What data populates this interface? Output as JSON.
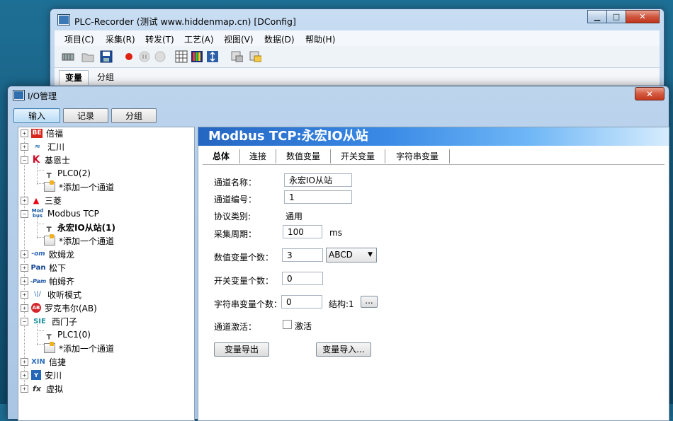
{
  "main_window": {
    "title": "PLC-Recorder (测试 www.hiddenmap.cn) [DConfig]",
    "menu": [
      "项目(C)",
      "采集(R)",
      "转发(T)",
      "工艺(A)",
      "视图(V)",
      "数据(D)",
      "帮助(H)"
    ],
    "tabs": [
      "变量",
      "分组"
    ]
  },
  "io_dialog": {
    "title": "I/O管理",
    "tabs": [
      "输入",
      "记录",
      "分组"
    ],
    "tree": [
      {
        "label": "倍福",
        "logo": "BE"
      },
      {
        "label": "汇川",
        "logo": "≈"
      },
      {
        "label": "基恩士",
        "logo": "K"
      },
      {
        "label": "PLC0(2)"
      },
      {
        "label": "*添加一个通道"
      },
      {
        "label": "三菱",
        "logo": "▲"
      },
      {
        "label": "Modbus TCP",
        "logo_top": "Mod",
        "logo_bottom": "bus"
      },
      {
        "label": "永宏IO从站(1)"
      },
      {
        "label": "*添加一个通道"
      },
      {
        "label": "欧姆龙",
        "logo": "-om"
      },
      {
        "label": "松下",
        "logo": "Pan"
      },
      {
        "label": "帕姆齐",
        "logo": "-Pam"
      },
      {
        "label": "收听模式",
        "logo": "\\|/"
      },
      {
        "label": "罗克韦尔(AB)",
        "logo": "AB"
      },
      {
        "label": "西门子",
        "logo": "SIE"
      },
      {
        "label": "PLC1(0)"
      },
      {
        "label": "*添加一个通道"
      },
      {
        "label": "信捷",
        "logo": "XIN"
      },
      {
        "label": "安川",
        "logo": "Y"
      },
      {
        "label": "虚拟",
        "logo": "fx"
      }
    ],
    "detail": {
      "header": "Modbus TCP:永宏IO从站",
      "tabs": [
        "总体",
        "连接",
        "数值变量",
        "开关变量",
        "字符串变量"
      ],
      "fields": {
        "channel_name_label": "通道名称：",
        "channel_name": "永宏IO从站",
        "channel_no_label": "通道编号：",
        "channel_no": "1",
        "protocol_label": "协议类别:",
        "protocol": "通用",
        "period_label": "采集周期：",
        "period": "100",
        "period_unit": "ms",
        "num_vars_label": "数值变量个数：",
        "num_vars": "3",
        "byte_order": "ABCD",
        "bool_vars_label": "开关变量个数：",
        "bool_vars": "0",
        "str_vars_label": "字符串变量个数：",
        "str_vars": "0",
        "struct_label": "结构:1",
        "struct_btn": "...",
        "activate_label": "通道激活：",
        "activate_text": "激活",
        "export_btn": "变量导出",
        "import_btn": "变量导入..."
      }
    }
  }
}
